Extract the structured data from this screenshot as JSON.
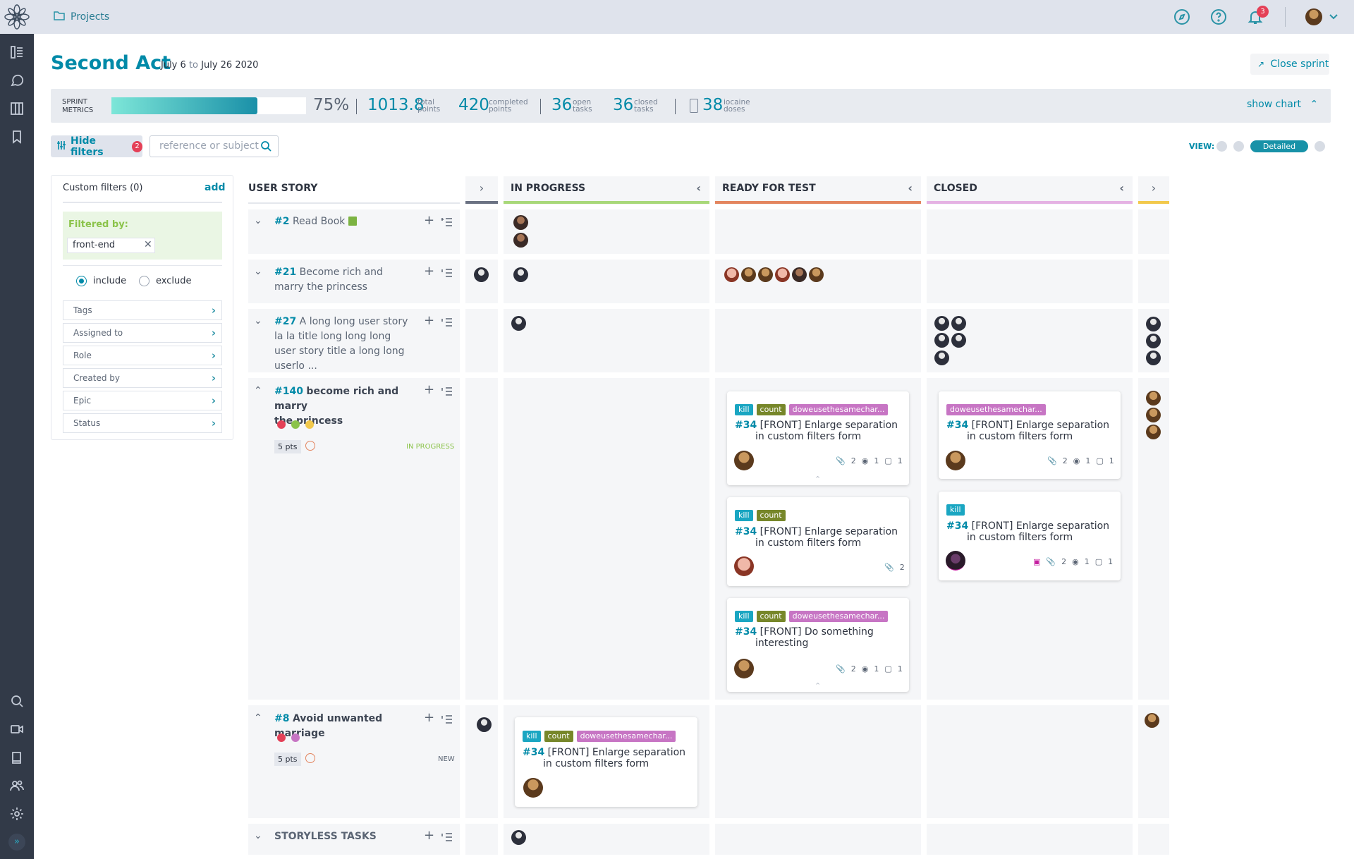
{
  "topbar": {
    "projects_label": "Projects",
    "notifications_count": "3"
  },
  "header": {
    "sprint_name": "Second Act",
    "date_start": "July 6",
    "date_to": "to",
    "date_end": "July 26 2020",
    "close_sprint_label": "Close sprint"
  },
  "metrics": {
    "label_line1": "SPRINT",
    "label_line2": "METRICS",
    "progress_fraction": 0.75,
    "progress_text": "75%",
    "total_points": "1013.8",
    "total_label1": "total",
    "total_label2": "points",
    "completed_points": "420",
    "completed_label1": "completed",
    "completed_label2": "points",
    "open_tasks": "36",
    "open_label1": "open",
    "open_label2": "tasks",
    "closed_tasks": "36",
    "closed_label1": "closed",
    "closed_label2": "tasks",
    "iocaine": "38",
    "iocaine_label1": "iocaine",
    "iocaine_label2": "doses",
    "show_chart_label": "show chart"
  },
  "filters": {
    "hide_filters_label": "Hide filters",
    "hide_filters_count": "2",
    "search_placeholder": "reference or subject",
    "custom_filters_label": "Custom filters (0)",
    "add_label": "add",
    "filtered_by_label": "Filtered by:",
    "active_filter": "front-end",
    "include_label": "include",
    "exclude_label": "exclude",
    "categories": [
      "Tags",
      "Assigned to",
      "Role",
      "Created by",
      "Epic",
      "Status"
    ]
  },
  "view": {
    "label": "VIEW:",
    "detailed_label": "Detailed"
  },
  "columns": {
    "user_story": "USER STORY",
    "in_progress": "IN PROGRESS",
    "ready_for_test": "READY FOR TEST",
    "closed": "CLOSED"
  },
  "colors": {
    "in_progress": "#a8d879",
    "ready_for_test": "#e3855f",
    "closed": "#e5b2e3",
    "new": "#6b7283",
    "last": "#f2c94c"
  },
  "stories": [
    {
      "ref": "#2",
      "title": "Read Book"
    },
    {
      "ref": "#21",
      "title": "Become rich and marry the princess"
    },
    {
      "ref": "#27",
      "title": "A long long user story la la title long long long user story title a long long userlo ..."
    },
    {
      "ref": "#140",
      "title_line1": "become rich and marry",
      "title_line2": "the princess",
      "points": "5 pts",
      "status": "IN PROGRESS"
    },
    {
      "ref": "#8",
      "title": "Avoid unwanted marriage",
      "points": "5 pts",
      "status": "NEW"
    }
  ],
  "storyless_label": "STORYLESS TASKS",
  "tags": {
    "kill": "kill",
    "count": "count",
    "doweuse": "doweusethesamechar..."
  },
  "cards": {
    "ref": "#34",
    "enlarge_line1": "[FRONT] Enlarge separation",
    "enlarge_line2": "in custom filters form",
    "interesting_line1": "[FRONT] Do something",
    "interesting_line2": "interesting",
    "attach": "2",
    "watch": "1",
    "comment": "1"
  }
}
